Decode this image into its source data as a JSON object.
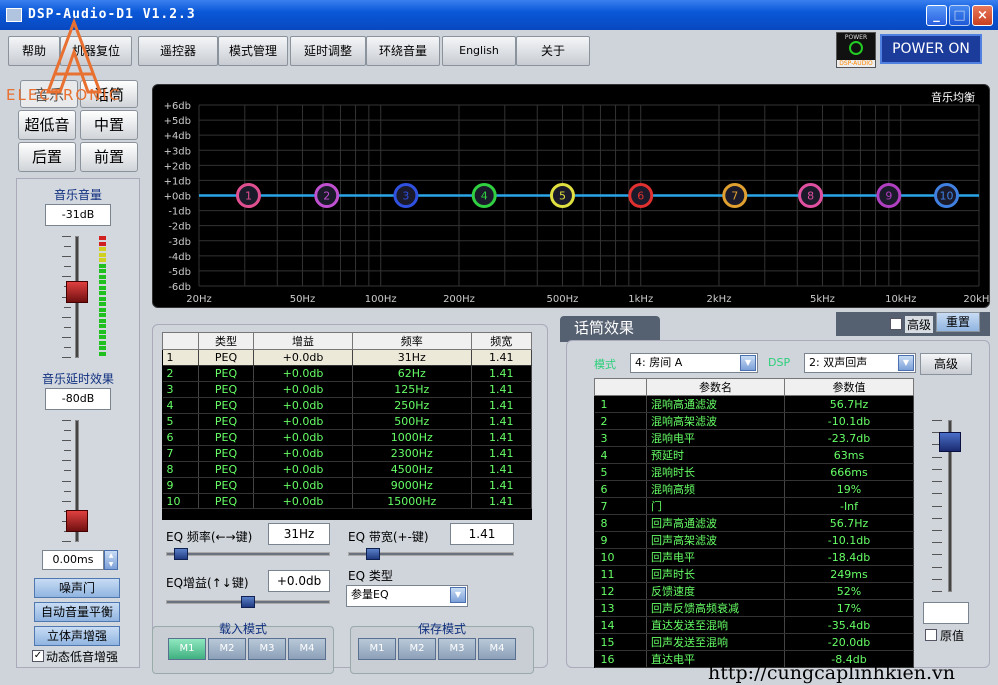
{
  "window": {
    "title": "DSP-Audio-D1 V1.2.3"
  },
  "logo": {
    "text": "ELECTRONIC",
    "letter": "A"
  },
  "menu": [
    "帮助",
    "机器复位",
    "遥控器",
    "模式管理",
    "延时调整",
    "环绕音量",
    "English",
    "关于"
  ],
  "power": {
    "icon_label": "POWER",
    "brand": "DSP-AUDIO",
    "button": "POWER ON"
  },
  "left": {
    "tabs": [
      "音乐",
      "话筒",
      "超低音",
      "中置",
      "后置",
      "前置"
    ],
    "music_volume": {
      "label": "音乐音量",
      "value": "-31dB",
      "level": 0.55
    },
    "music_delay": {
      "label": "音乐延时效果",
      "value": "-80dB",
      "delay": "0.00ms",
      "level": 0.1
    },
    "buttons": [
      "噪声门",
      "自动音量平衡",
      "立体声增强"
    ],
    "checkbox": {
      "label": "动态低音增强",
      "checked": true
    }
  },
  "graph": {
    "title": "音乐均衡",
    "y_labels": [
      "+6db",
      "+5db",
      "+4db",
      "+3db",
      "+2db",
      "+1db",
      "+0db",
      "-1db",
      "-2db",
      "-3db",
      "-4db",
      "-5db",
      "-6db"
    ],
    "x_labels": [
      "20Hz",
      "50Hz",
      "100Hz",
      "200Hz",
      "500Hz",
      "1kHz",
      "2kHz",
      "5kHz",
      "10kHz",
      "20kHz"
    ],
    "colors": {
      "line": "#2aa6e8",
      "grid": "#333333",
      "bg": "#000000"
    }
  },
  "chart_data": {
    "type": "line",
    "title": "音乐均衡",
    "x_scale": "log",
    "xlim": [
      20,
      20000
    ],
    "ylim": [
      -6,
      6
    ],
    "grid": true,
    "points": [
      {
        "label": "1",
        "freq": 31,
        "gain": 0,
        "color": "#e05090"
      },
      {
        "label": "2",
        "freq": 62,
        "gain": 0,
        "color": "#c050d0"
      },
      {
        "label": "3",
        "freq": 125,
        "gain": 0,
        "color": "#3050e0"
      },
      {
        "label": "4",
        "freq": 250,
        "gain": 0,
        "color": "#30d040"
      },
      {
        "label": "5",
        "freq": 500,
        "gain": 0,
        "color": "#e0e040"
      },
      {
        "label": "6",
        "freq": 1000,
        "gain": 0,
        "color": "#e03030"
      },
      {
        "label": "7",
        "freq": 2300,
        "gain": 0,
        "color": "#e0a030"
      },
      {
        "label": "8",
        "freq": 4500,
        "gain": 0,
        "color": "#e050a0"
      },
      {
        "label": "9",
        "freq": 9000,
        "gain": 0,
        "color": "#b040c0"
      },
      {
        "label": "10",
        "freq": 15000,
        "gain": 0,
        "color": "#4080e0"
      }
    ]
  },
  "eq_table": {
    "headers": [
      "",
      "类型",
      "增益",
      "频率",
      "频宽"
    ],
    "rows": [
      [
        "1",
        "PEQ",
        "+0.0db",
        "31Hz",
        "1.41"
      ],
      [
        "2",
        "PEQ",
        "+0.0db",
        "62Hz",
        "1.41"
      ],
      [
        "3",
        "PEQ",
        "+0.0db",
        "125Hz",
        "1.41"
      ],
      [
        "4",
        "PEQ",
        "+0.0db",
        "250Hz",
        "1.41"
      ],
      [
        "5",
        "PEQ",
        "+0.0db",
        "500Hz",
        "1.41"
      ],
      [
        "6",
        "PEQ",
        "+0.0db",
        "1000Hz",
        "1.41"
      ],
      [
        "7",
        "PEQ",
        "+0.0db",
        "2300Hz",
        "1.41"
      ],
      [
        "8",
        "PEQ",
        "+0.0db",
        "4500Hz",
        "1.41"
      ],
      [
        "9",
        "PEQ",
        "+0.0db",
        "9000Hz",
        "1.41"
      ],
      [
        "10",
        "PEQ",
        "+0.0db",
        "15000Hz",
        "1.41"
      ]
    ]
  },
  "eq_controls": {
    "freq_label": "EQ 频率(←→键)",
    "freq_value": "31Hz",
    "bw_label": "EQ 带宽(+-键)",
    "bw_value": "1.41",
    "gain_label": "EQ增益(↑↓键)",
    "gain_value": "+0.0db",
    "type_label": "EQ 类型",
    "type_value": "参量EQ",
    "freq_level": 0.05,
    "bw_level": 0.12,
    "gain_level": 0.5
  },
  "modes": {
    "load_label": "载入模式",
    "save_label": "保存模式",
    "buttons": [
      "M1",
      "M2",
      "M3",
      "M4"
    ]
  },
  "mic": {
    "title": "话筒效果",
    "advanced_check": "高级",
    "reset": "重置",
    "mode_label": "模式",
    "mode_value": "4: 房间 A",
    "dsp_label": "DSP",
    "dsp_value": "2: 双声回声",
    "advanced_btn": "高级",
    "original_check": "原值",
    "headers": [
      "",
      "参数名",
      "参数值"
    ],
    "rows": [
      [
        "1",
        "混响高通滤波",
        "56.7Hz"
      ],
      [
        "2",
        "混响高架滤波",
        "-10.1db"
      ],
      [
        "3",
        "混响电平",
        "-23.7db"
      ],
      [
        "4",
        "预延时",
        "63ms"
      ],
      [
        "5",
        "混响时长",
        "666ms"
      ],
      [
        "6",
        "混响高频",
        "19%"
      ],
      [
        "7",
        "门",
        "-Inf"
      ],
      [
        "8",
        "回声高通滤波",
        "56.7Hz"
      ],
      [
        "9",
        "回声高架滤波",
        "-10.1db"
      ],
      [
        "10",
        "回声电平",
        "-18.4db"
      ],
      [
        "11",
        "回声时长",
        "249ms"
      ],
      [
        "12",
        "反馈速度",
        "52%"
      ],
      [
        "13",
        "回声反馈高频衰减",
        "17%"
      ],
      [
        "14",
        "直达发送至混响",
        "-35.4db"
      ],
      [
        "15",
        "回声发送至混响",
        "-20.0db"
      ],
      [
        "16",
        "直达电平",
        "-8.4db"
      ]
    ]
  },
  "watermark": "http://cungcaplinhkien.vn"
}
